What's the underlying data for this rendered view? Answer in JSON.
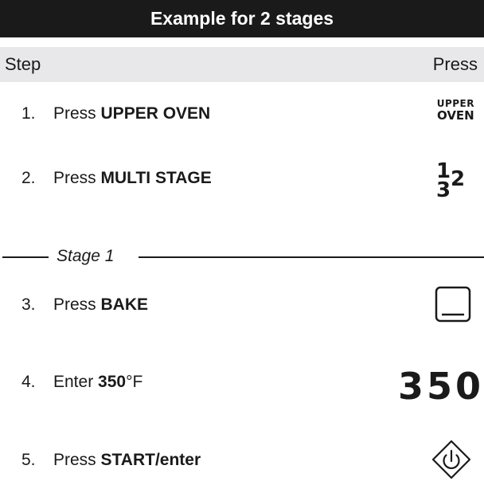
{
  "title": "Example for 2 stages",
  "header": {
    "step": "Step",
    "press": "Press"
  },
  "steps": [
    {
      "num": "1.",
      "prefix": "Press ",
      "bold": "UPPER OVEN",
      "suffix": ""
    },
    {
      "num": "2.",
      "prefix": "Press ",
      "bold": "MULTI STAGE",
      "suffix": ""
    },
    {
      "num": "3.",
      "prefix": "Press ",
      "bold": "BAKE",
      "suffix": ""
    },
    {
      "num": "4.",
      "prefix": "Enter ",
      "bold": "350",
      "suffix": "°F"
    },
    {
      "num": "5.",
      "prefix": "Press ",
      "bold": "START/enter",
      "suffix": ""
    }
  ],
  "stage_label": "Stage 1",
  "icons": {
    "upper_oven": {
      "name": "upper-oven-key-icon",
      "line1": "UPPER",
      "line2": "OVEN"
    },
    "multi_stage": {
      "name": "multi-stage-key-icon",
      "d1": "1",
      "d2": "2",
      "d3": "3"
    },
    "bake": {
      "name": "bake-key-icon"
    },
    "temperature": {
      "name": "temperature-display-icon",
      "text": "350"
    },
    "start": {
      "name": "start-enter-key-icon"
    }
  },
  "colors": {
    "title_bg": "#1a1a1a",
    "header_bg": "#e8e8ea",
    "text": "#1a1a1a"
  }
}
